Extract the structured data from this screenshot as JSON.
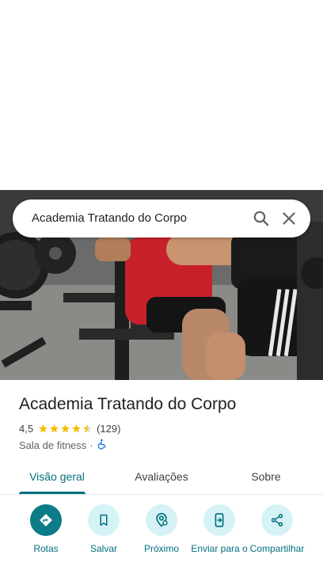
{
  "search": {
    "query": "Academia Tratando do Corpo"
  },
  "place": {
    "title": "Academia Tratando do Corpo",
    "rating": "4,5",
    "stars": 4.5,
    "review_count": "(129)",
    "category": "Sala de fitness",
    "separator": "·"
  },
  "tabs": [
    {
      "label": "Visão geral",
      "active": true
    },
    {
      "label": "Avaliações",
      "active": false
    },
    {
      "label": "Sobre",
      "active": false
    }
  ],
  "actions": [
    {
      "label": "Rotas",
      "icon": "directions-icon"
    },
    {
      "label": "Salvar",
      "icon": "bookmark-icon"
    },
    {
      "label": "Próximo",
      "icon": "nearby-icon"
    },
    {
      "label": "Enviar para o",
      "icon": "send-to-phone-icon"
    },
    {
      "label": "Compartilhar",
      "icon": "share-icon"
    }
  ],
  "colors": {
    "accent": "#00707f",
    "primary_button": "#0b7c88",
    "secondary_button": "#d5f3f6",
    "star": "#fbbc04"
  }
}
